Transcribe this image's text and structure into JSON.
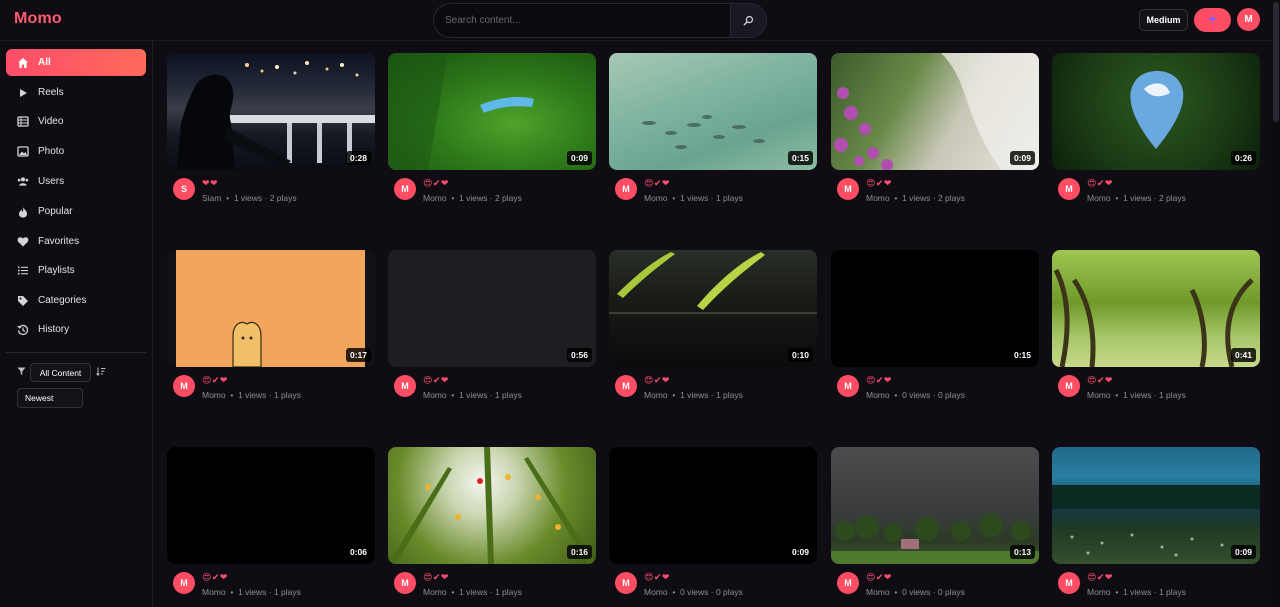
{
  "app": {
    "logo": "Momo"
  },
  "search": {
    "placeholder": "Search content..."
  },
  "header": {
    "quality_label": "Medium",
    "create_label": "+",
    "avatar_initial": "M"
  },
  "sidebar": {
    "items": [
      {
        "label": "All",
        "icon": "home-icon"
      },
      {
        "label": "Reels",
        "icon": "play-icon"
      },
      {
        "label": "Video",
        "icon": "film-icon"
      },
      {
        "label": "Photo",
        "icon": "image-icon"
      },
      {
        "label": "Users",
        "icon": "users-icon"
      },
      {
        "label": "Popular",
        "icon": "flame-icon"
      },
      {
        "label": "Favorites",
        "icon": "heart-icon"
      },
      {
        "label": "Playlists",
        "icon": "list-icon"
      },
      {
        "label": "Categories",
        "icon": "tag-icon"
      },
      {
        "label": "History",
        "icon": "history-icon"
      }
    ],
    "filter": {
      "content_value": "All Content",
      "sort_value": "Newest"
    }
  },
  "colors": {
    "accent": "#ff4d63",
    "background": "#0f0d13"
  },
  "cards": [
    {
      "duration": "0:28",
      "avatar": "S",
      "reactions": "❤❤",
      "author": "Siam",
      "stats": "1 views · 2 plays"
    },
    {
      "duration": "0:09",
      "avatar": "M",
      "reactions": "😍✔❤",
      "author": "Momo",
      "stats": "1 views · 2 plays"
    },
    {
      "duration": "0:15",
      "avatar": "M",
      "reactions": "😍✔❤",
      "author": "Momo",
      "stats": "1 views · 1 plays"
    },
    {
      "duration": "0:09",
      "avatar": "M",
      "reactions": "😍✔❤",
      "author": "Momo",
      "stats": "1 views · 2 plays"
    },
    {
      "duration": "0:26",
      "avatar": "M",
      "reactions": "😍✔❤",
      "author": "Momo",
      "stats": "1 views · 2 plays"
    },
    {
      "duration": "0:17",
      "avatar": "M",
      "reactions": "😍✔❤",
      "author": "Momo",
      "stats": "1 views · 1 plays"
    },
    {
      "duration": "0:56",
      "avatar": "M",
      "reactions": "😍✔❤",
      "author": "Momo",
      "stats": "1 views · 1 plays"
    },
    {
      "duration": "0:10",
      "avatar": "M",
      "reactions": "😍✔❤",
      "author": "Momo",
      "stats": "1 views · 1 plays"
    },
    {
      "duration": "0:15",
      "avatar": "M",
      "reactions": "😍✔❤",
      "author": "Momo",
      "stats": "0 views · 0 plays"
    },
    {
      "duration": "0:41",
      "avatar": "M",
      "reactions": "😍✔❤",
      "author": "Momo",
      "stats": "1 views · 1 plays"
    },
    {
      "duration": "0:06",
      "avatar": "M",
      "reactions": "😍✔❤",
      "author": "Momo",
      "stats": "1 views · 1 plays"
    },
    {
      "duration": "0:16",
      "avatar": "M",
      "reactions": "😍✔❤",
      "author": "Momo",
      "stats": "1 views · 1 plays"
    },
    {
      "duration": "0:09",
      "avatar": "M",
      "reactions": "😍✔❤",
      "author": "Momo",
      "stats": "0 views · 0 plays"
    },
    {
      "duration": "0:13",
      "avatar": "M",
      "reactions": "😍✔❤",
      "author": "Momo",
      "stats": "0 views · 0 plays"
    },
    {
      "duration": "0:09",
      "avatar": "M",
      "reactions": "😍✔❤",
      "author": "Momo",
      "stats": "1 views · 1 plays"
    }
  ]
}
